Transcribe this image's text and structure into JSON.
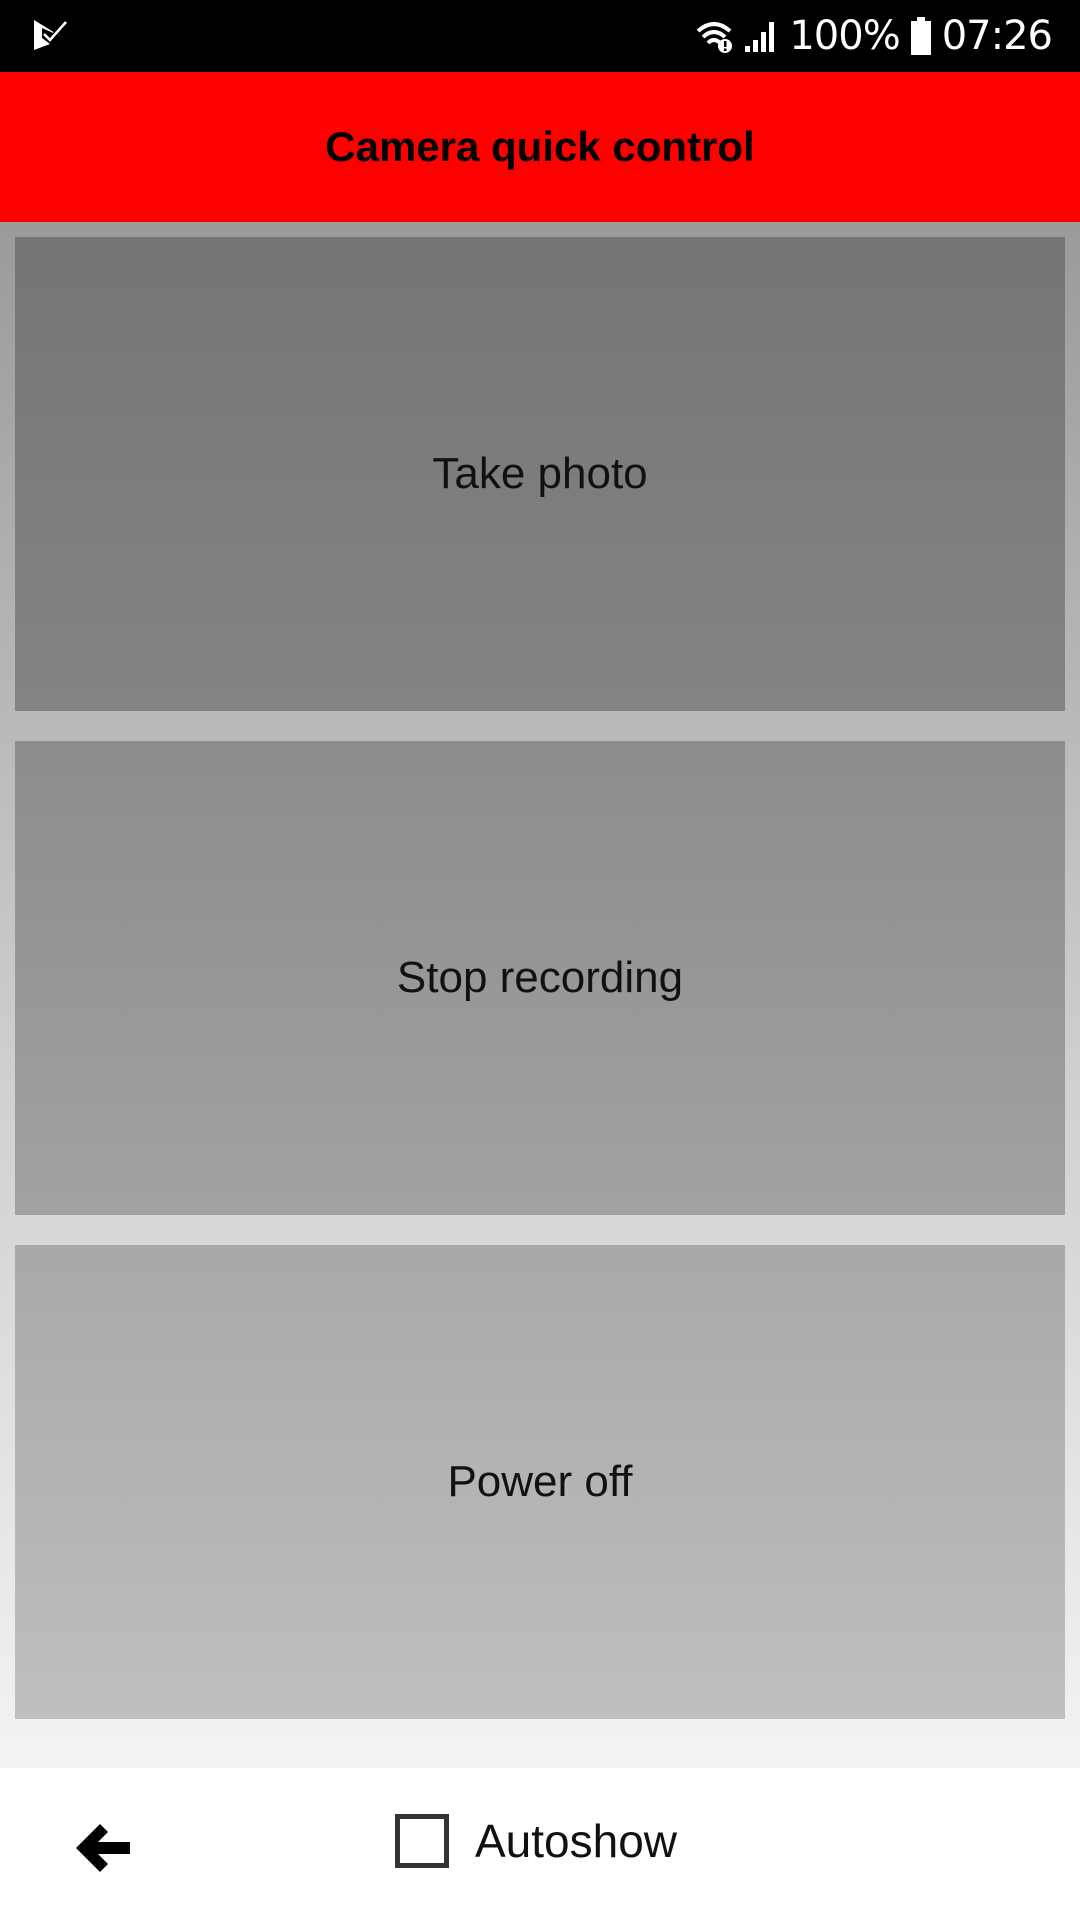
{
  "status_bar": {
    "battery_percent": "100%",
    "time": "07:26",
    "icons": [
      "app-notification-icon",
      "wifi-icon",
      "signal-icon",
      "battery-icon"
    ]
  },
  "app_bar": {
    "title": "Camera quick control",
    "color": "#ff0000"
  },
  "actions": {
    "take_photo": "Take photo",
    "stop_recording": "Stop recording",
    "power_off": "Power off"
  },
  "bottom_bar": {
    "back_icon": "arrow-left-icon",
    "autoshow_label": "Autoshow",
    "autoshow_checked": false
  }
}
